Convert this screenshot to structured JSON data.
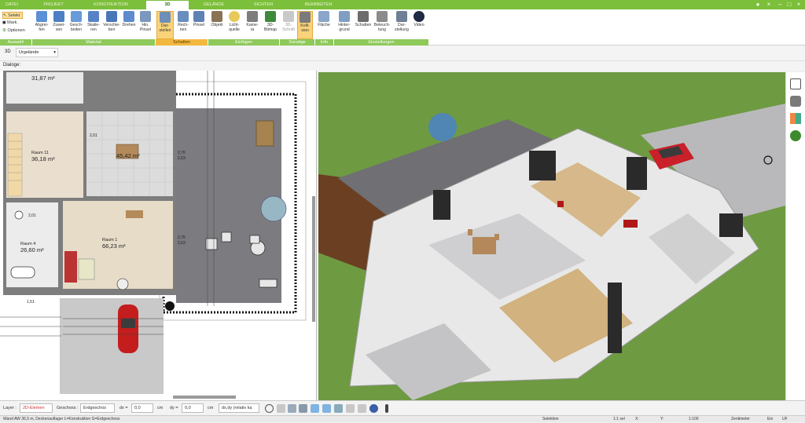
{
  "tabs": [
    "DATEI",
    "PROJEKT",
    "KONSTRUKTION",
    "3D",
    "GELÄNDE",
    "SICHTEN",
    "BEARBEITEN"
  ],
  "active_tab": "3D",
  "ribbon": {
    "select_label": "Selekt",
    "mark_label": "Mark.",
    "options_label": "Optionen",
    "buttons": [
      {
        "label": "Abgrei-\nfen"
      },
      {
        "label": "Zuwei-\nsen"
      },
      {
        "label": "Gesch-\nbeiten"
      },
      {
        "label": "Skalie-\nren"
      },
      {
        "label": "Verschie-\nben"
      },
      {
        "label": "Drehen"
      },
      {
        "label": "Hin.\nPinsel"
      },
      {
        "label": "Dar-\nstellen"
      },
      {
        "label": "Rech-\nnen"
      },
      {
        "label": "Pinsel"
      },
      {
        "label": "Objekt"
      },
      {
        "label": "Licht-\nquelle"
      },
      {
        "label": "Kame-\nra"
      },
      {
        "label": "3D-\nBitmap"
      },
      {
        "label": "3D-\nSchnitt"
      },
      {
        "label": "Kolli-\nsion"
      },
      {
        "label": "Fläche"
      },
      {
        "label": "Hinter-\ngrund"
      },
      {
        "label": "Schatten"
      },
      {
        "label": "Beleuch-\ntung"
      },
      {
        "label": "Dar-\nstellung"
      },
      {
        "label": "Video"
      }
    ],
    "groups": [
      "Auswahl",
      "Material",
      "Schatten",
      "Einfügen",
      "Sonstige",
      "Info",
      "Einstellungen"
    ]
  },
  "toolbar2": {
    "mode": "3D",
    "terrain": "Urgelände"
  },
  "dialog_label": "Dialoge:",
  "plan": {
    "rooms": [
      {
        "name": "",
        "area": "31,87 m²"
      },
      {
        "name": "Raum 11",
        "area": "36,18 m²"
      },
      {
        "name": "",
        "area": "45,42 m²"
      },
      {
        "name": "Raum 1",
        "area": "66,23 m²"
      },
      {
        "name": "Raum 4",
        "area": "26,60 m²"
      }
    ],
    "dims": [
      "2,01",
      "2,76\n2,63",
      "2,76\n2,63",
      "2,01",
      "1,51"
    ]
  },
  "bottom": {
    "layer_label": "Layer :",
    "layer_value": "2D-Elemen",
    "floor_label": "Geschoss :",
    "floor_value": "Erdgeschos",
    "dx_label": "dx =",
    "dx_value": "0,0",
    "dx_unit": "cm",
    "dy_label": "dy =",
    "dy_value": "0,0",
    "dy_unit": "cm",
    "mode_value": "dx,dy (relativ kа"
  },
  "status": {
    "message": "Wand AW 36,5 m, Deckenauflager L=Konstruktion G=Erdgeschoss",
    "selection": "Selektion",
    "sel_count": "1:1 sel",
    "x": "X:",
    "y": "Y:",
    "scale": "1:100",
    "unit": "Zentimeter",
    "ein": "Ein",
    "uf": "UF"
  },
  "colors": {
    "accent": "#7cbf3a",
    "highlight": "#f3b840",
    "grass": "#5f8a3a"
  }
}
